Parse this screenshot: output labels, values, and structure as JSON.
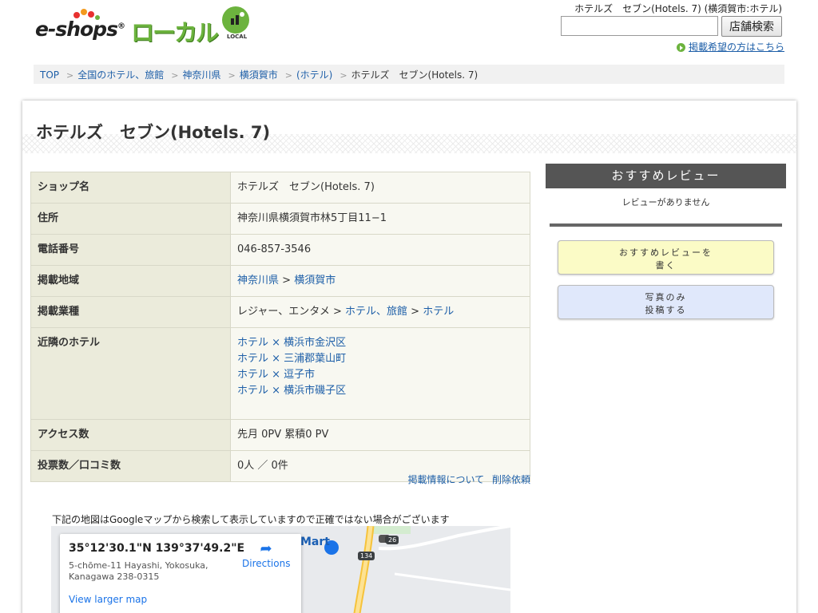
{
  "header": {
    "logo_text": "e-shops",
    "logo_local": "ローカル",
    "logo_badge": "LOCAL",
    "page_heading": "ホテルズ　セブン(Hotels. 7) (横須賀市:ホテル)",
    "search_placeholder": "",
    "search_button": "店舗検索",
    "listing_link": "掲載希望の方はこちら"
  },
  "breadcrumb": [
    {
      "label": "TOP"
    },
    {
      "label": "全国のホテル、旅館"
    },
    {
      "label": "神奈川県"
    },
    {
      "label": "横須賀市"
    },
    {
      "label": "(ホテル)"
    }
  ],
  "breadcrumb_current": "ホテルズ　セブン(Hotels. 7)",
  "title": "ホテルズ　セブン(Hotels. 7)",
  "info": {
    "shop_name_label": "ショップ名",
    "shop_name": "ホテルズ　セブン(Hotels. 7)",
    "address_label": "住所",
    "address": "神奈川県横須賀市林5丁目11−1",
    "phone_label": "電話番号",
    "phone": "046-857-3546",
    "area_label": "掲載地域",
    "area_pref": "神奈川県",
    "area_city": "横須賀市",
    "category_label": "掲載業種",
    "category_prefix": "レジャー、エンタメ",
    "category_mid": "ホテル、旅館",
    "category_leaf": "ホテル",
    "nearby_label": "近隣のホテル",
    "nearby": [
      "ホテル × 横浜市金沢区",
      "ホテル × 三浦郡葉山町",
      "ホテル × 逗子市",
      "ホテル × 横浜市磯子区"
    ],
    "access_label": "アクセス数",
    "access": "先月 0PV 累積0 PV",
    "votes_label": "投票数／口コミ数",
    "votes": "0人 ／ 0件"
  },
  "footer_links": {
    "about": "掲載情報について",
    "delete": "削除依頼"
  },
  "map": {
    "note": "下記の地図はGoogleマップから検索して表示していますので正確ではない場合がございます",
    "coords": "35°12'30.1\"N 139°37'49.2\"E",
    "address": "5-chōme-11 Hayashi, Yokosuka, Kanagawa 238-0315",
    "directions": "Directions",
    "larger": "View larger map",
    "label_mart": "Mart",
    "label_road_134": "134",
    "label_road_26": "26"
  },
  "sidebar": {
    "review_header": "おすすめレビュー",
    "no_reviews": "レビューがありません",
    "write_review_line1": "おすすめレビューを",
    "write_review_line2": "書く",
    "post_photo_line1": "写真のみ",
    "post_photo_line2": "投稿する"
  },
  "colors": {
    "brand_green": "#6cb33e",
    "link": "#1e5fa8",
    "label_bg": "#ebebdb",
    "review_header_bg": "#555555"
  }
}
